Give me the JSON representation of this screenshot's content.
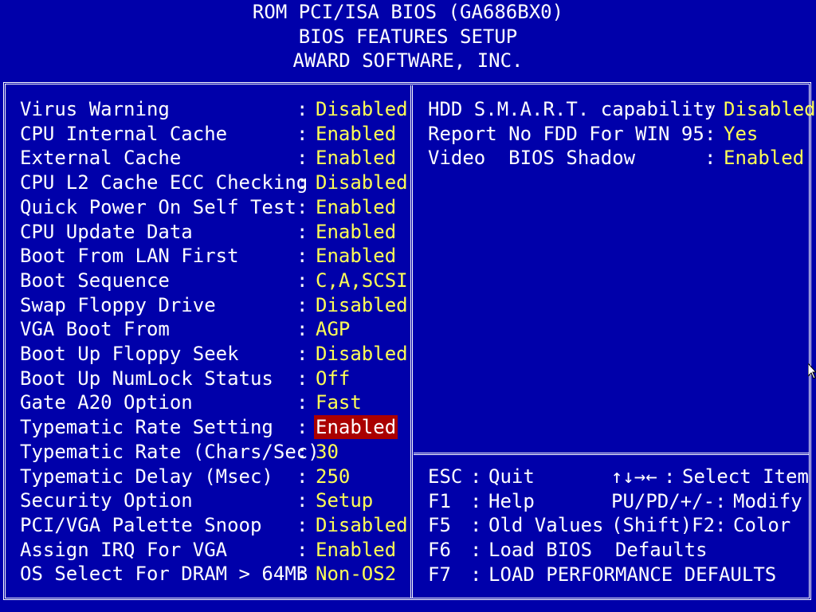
{
  "header": {
    "line1": "ROM PCI/ISA BIOS (GA686BX0)",
    "line2": "BIOS FEATURES SETUP",
    "line3": "AWARD SOFTWARE, INC."
  },
  "left_settings": [
    {
      "label": "Virus Warning",
      "value": "Disabled"
    },
    {
      "label": "CPU Internal Cache",
      "value": "Enabled"
    },
    {
      "label": "External Cache",
      "value": "Enabled"
    },
    {
      "label": "CPU L2 Cache ECC Checking",
      "value": "Disabled"
    },
    {
      "label": "Quick Power On Self Test",
      "value": "Enabled"
    },
    {
      "label": "CPU Update Data",
      "value": "Enabled"
    },
    {
      "label": "Boot From LAN First",
      "value": "Enabled"
    },
    {
      "label": "Boot Sequence",
      "value": "C,A,SCSI"
    },
    {
      "label": "Swap Floppy Drive",
      "value": "Disabled"
    },
    {
      "label": "VGA Boot From",
      "value": "AGP"
    },
    {
      "label": "Boot Up Floppy Seek",
      "value": "Disabled"
    },
    {
      "label": "Boot Up NumLock Status",
      "value": "Off"
    },
    {
      "label": "Gate A20 Option",
      "value": "Fast"
    },
    {
      "label": "Typematic Rate Setting",
      "value": "Enabled"
    },
    {
      "label": "Typematic Rate (Chars/Sec)",
      "value": "30"
    },
    {
      "label": "Typematic Delay (Msec)",
      "value": "250"
    },
    {
      "label": "Security Option",
      "value": "Setup"
    },
    {
      "label": "PCI/VGA Palette Snoop",
      "value": "Disabled"
    },
    {
      "label": "Assign IRQ For VGA",
      "value": "Enabled"
    },
    {
      "label": "OS Select For DRAM > 64MB",
      "value": "Non-OS2"
    }
  ],
  "selected_index": 13,
  "right_settings": [
    {
      "label": "HDD S.M.A.R.T. capability",
      "value": "Disabled"
    },
    {
      "label": "Report No FDD For WIN 95",
      "value": "Yes"
    },
    {
      "label": "Video  BIOS Shadow",
      "value": "Enabled"
    }
  ],
  "help_keys": [
    {
      "key": "ESC",
      "action": "Quit",
      "key2": "↑↓→←",
      "action2": "Select Item"
    },
    {
      "key": "F1",
      "action": "Help",
      "key2": "PU/PD/+/-",
      "action2": "Modify"
    },
    {
      "key": "F5",
      "action": "Old Values",
      "key2": "(Shift)F2",
      "action2": "Color"
    },
    {
      "key": "F6",
      "action": "Load BIOS  Defaults",
      "key2": "",
      "action2": ""
    },
    {
      "key": "F7",
      "action": "LOAD PERFORMANCE DEFAULTS",
      "key2": "",
      "action2": ""
    }
  ],
  "colors": {
    "background": "#0000aa",
    "label": "#ffffff",
    "value": "#ffff55",
    "highlight": "#aa0000"
  }
}
